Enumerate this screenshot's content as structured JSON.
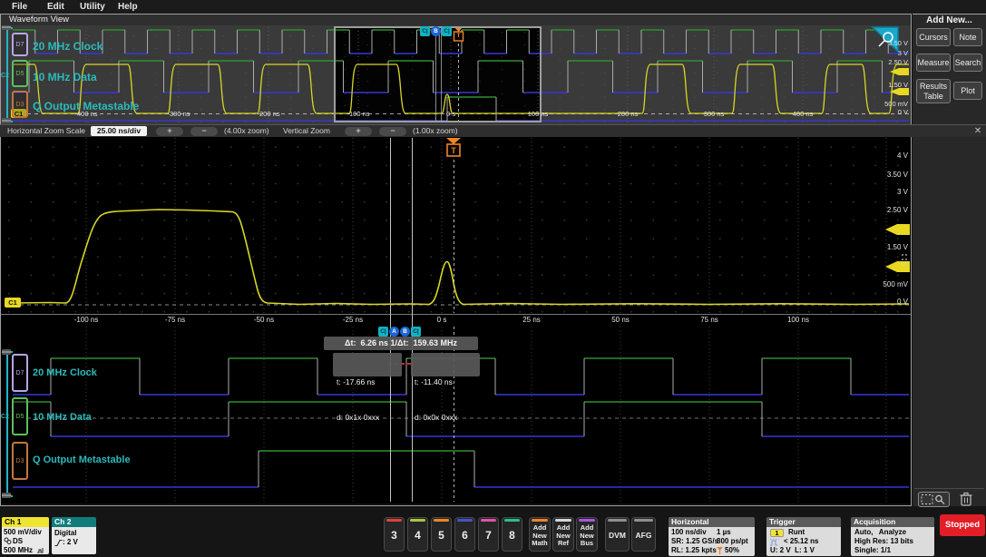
{
  "menu": {
    "items": [
      "File",
      "Edit",
      "Utility",
      "Help"
    ]
  },
  "view": {
    "title": "Waveform View"
  },
  "channels": [
    {
      "badge": "D7",
      "label": "20 MHz Clock",
      "color": "#b7a6e3"
    },
    {
      "badge": "D5",
      "label": "10 MHz Data",
      "color": "#5cbf5e",
      "group": "C2"
    },
    {
      "badge": "D3",
      "label": "Q Output Metastable",
      "color": "#c4763c"
    }
  ],
  "overview": {
    "x_ticks": [
      "-400 ns",
      "-300 ns",
      "-200 ns",
      "-100 ns",
      "0 s",
      "100 ns",
      "200 ns",
      "300 ns",
      "400 ns"
    ],
    "y_ticks": [
      "3.50 V",
      "3 V",
      "2.50 V",
      "1.50 V",
      "500 mV",
      "0 V"
    ],
    "c1_badge": "C1"
  },
  "zoom_toolbar": {
    "h_label": "Horizontal Zoom Scale",
    "h_scale": "25.00 ns/div",
    "plus": "+",
    "minus": "−",
    "h_zoom": "(4.00x zoom)",
    "v_label": "Vertical Zoom",
    "v_zoom": "(1.00x zoom)",
    "close": "✕"
  },
  "main": {
    "x_ticks": [
      "-100 ns",
      "-75 ns",
      "-50 ns",
      "-25 ns",
      "0 s",
      "25 ns",
      "50 ns",
      "75 ns",
      "100 ns"
    ],
    "y_ticks": [
      "4 V",
      "3.50 V",
      "3 V",
      "2.50 V",
      "1.50 V",
      "500 mV",
      "0 V"
    ],
    "trigger_label": "T",
    "c1_badge": "C1"
  },
  "cursors": {
    "top_badges": [
      "C|",
      "B",
      "C|"
    ],
    "bottom_badges": [
      "C|",
      "A",
      "B",
      "C|"
    ],
    "dt_readout": "Δt:  6.26 ns 1/Δt:  159.63 MHz",
    "a_readout": {
      "t": "t: -17.66 ns",
      "d": "d: 0x1x 0xxx"
    },
    "b_readout": {
      "t": "t: -11.40 ns",
      "d": "d: 0x0x 0xxx"
    }
  },
  "sidebar": {
    "header": "Add New...",
    "buttons": [
      "Cursors",
      "Note",
      "Measure",
      "Search",
      "Results Table",
      "Plot"
    ]
  },
  "badges_bar": {
    "ch1": {
      "name": "Ch 1",
      "scale": "500 mV/div",
      "probe": "DS",
      "bandwidth": "500 MHz",
      "color": "#efe42f"
    },
    "ch2": {
      "name": "Ch 2",
      "mode": "Digital",
      "threshold": ": 2 V",
      "color": "#127c7c"
    },
    "channel_buttons": [
      {
        "label": "3",
        "color": "#e0403a"
      },
      {
        "label": "4",
        "color": "#a8c83c"
      },
      {
        "label": "5",
        "color": "#f08428"
      },
      {
        "label": "6",
        "color": "#4453c8"
      },
      {
        "label": "7",
        "color": "#e052a8"
      },
      {
        "label": "8",
        "color": "#28c08c"
      }
    ],
    "add_buttons": [
      {
        "label": "Add New Math",
        "color": "#f08428"
      },
      {
        "label": "Add New Ref",
        "color": "#d8d8d8"
      },
      {
        "label": "Add New Bus",
        "color": "#a855e0"
      }
    ],
    "dvm": "DVM",
    "afg": "AFG",
    "horizontal": {
      "title": "Horizontal",
      "rows": [
        [
          "100 ns/div",
          "1 µs"
        ],
        [
          "SR: 1.25 GS/s",
          "800 ps/pt"
        ],
        [
          "RL: 1.25 kpts",
          "50%"
        ]
      ]
    },
    "trigger": {
      "title": "Trigger",
      "source": "1",
      "type": "Runt",
      "condition": "< 25.12 ns",
      "levels": "U: 2 V  L: 1 V"
    },
    "acquisition": {
      "title": "Acquisition",
      "rows": [
        "Auto,   Analyze",
        "High Res: 13 bits",
        "Single: 1/1"
      ]
    },
    "stopped": "Stopped"
  }
}
